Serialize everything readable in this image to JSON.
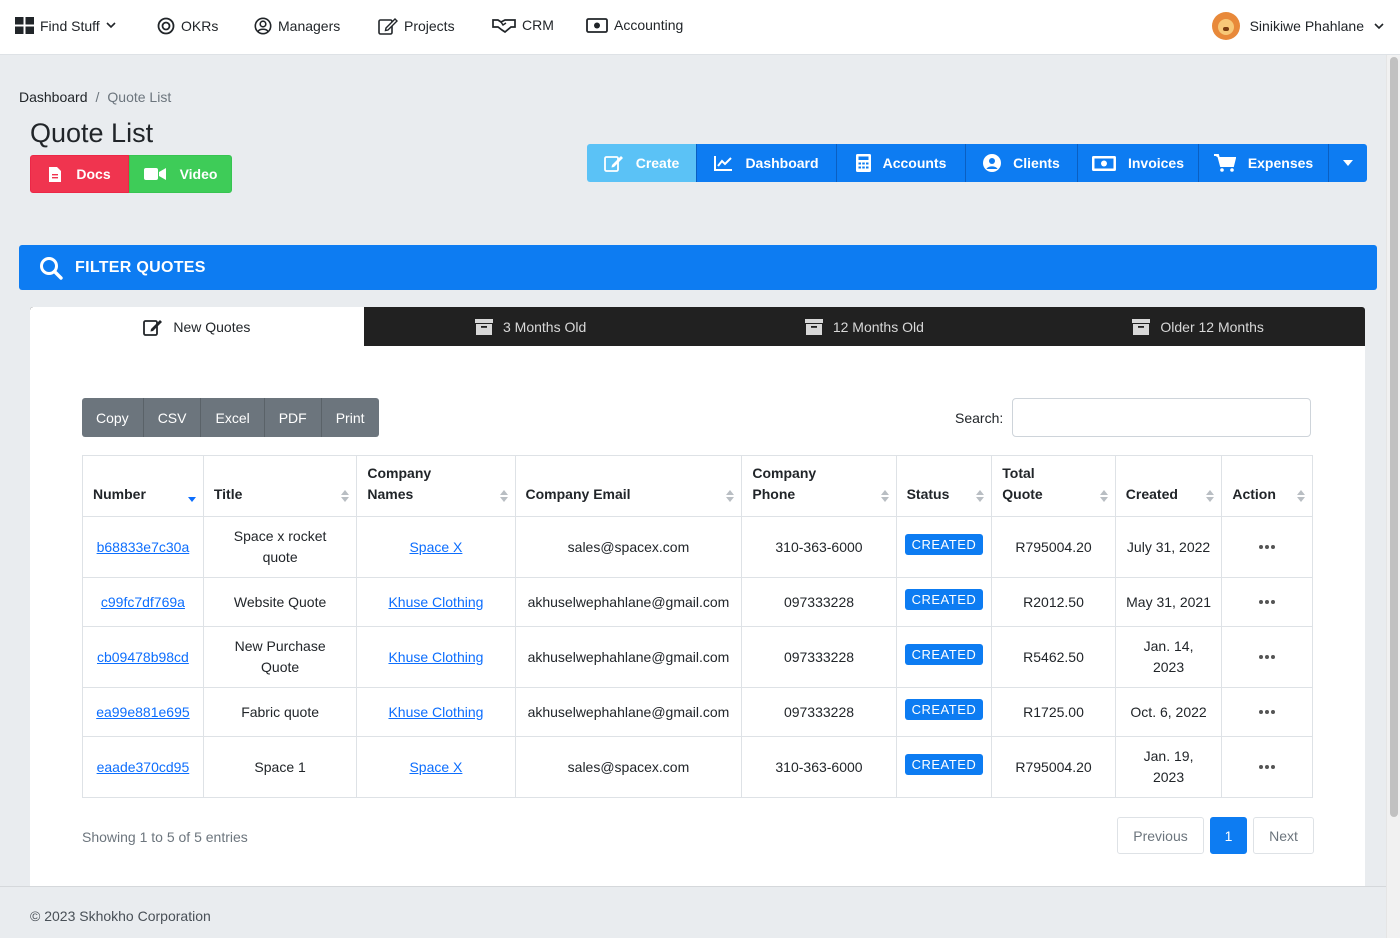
{
  "topnav": {
    "find_stuff": "Find Stuff",
    "okrs": "OKRs",
    "managers": "Managers",
    "projects": "Projects",
    "crm": "CRM",
    "accounting": "Accounting",
    "user_name": "Sinikiwe Phahlane"
  },
  "breadcrumb": {
    "home": "Dashboard",
    "separator": "/",
    "current": "Quote List"
  },
  "page_title": "Quote List",
  "help": {
    "docs": "Docs",
    "video": "Video"
  },
  "actions": {
    "create": "Create",
    "dashboard": "Dashboard",
    "accounts": "Accounts",
    "clients": "Clients",
    "invoices": "Invoices",
    "expenses": "Expenses"
  },
  "filter_label": "FILTER QUOTES",
  "tabs": {
    "new": "New Quotes",
    "three": "3 Months Old",
    "twelve": "12 Months Old",
    "older": "Older 12 Months"
  },
  "export": {
    "copy": "Copy",
    "csv": "CSV",
    "excel": "Excel",
    "pdf": "PDF",
    "print": "Print"
  },
  "search_label": "Search:",
  "table": {
    "headers": [
      "Number",
      "Title",
      "Company Names",
      "Company Email",
      "Company Phone",
      "Status",
      "Total Quote",
      "Created",
      "Action"
    ],
    "rows": [
      {
        "number": "b68833e7c30a",
        "title": "Space x rocket quote",
        "company": "Space X",
        "email": "sales@spacex.com",
        "phone": "310-363-6000",
        "status": "CREATED",
        "total": "R795004.20",
        "created": "July 31, 2022"
      },
      {
        "number": "c99fc7df769a",
        "title": "Website Quote",
        "company": "Khuse Clothing",
        "email": "akhuselwephahlane@gmail.com",
        "phone": "097333228",
        "status": "CREATED",
        "total": "R2012.50",
        "created": "May 31, 2021"
      },
      {
        "number": "cb09478b98cd",
        "title": "New Purchase Quote",
        "company": "Khuse Clothing",
        "email": "akhuselwephahlane@gmail.com",
        "phone": "097333228",
        "status": "CREATED",
        "total": "R5462.50",
        "created": "Jan. 14, 2023"
      },
      {
        "number": "ea99e881e695",
        "title": "Fabric quote",
        "company": "Khuse Clothing",
        "email": "akhuselwephahlane@gmail.com",
        "phone": "097333228",
        "status": "CREATED",
        "total": "R1725.00",
        "created": "Oct. 6, 2022"
      },
      {
        "number": "eaade370cd95",
        "title": "Space 1",
        "company": "Space X",
        "email": "sales@spacex.com",
        "phone": "310-363-6000",
        "status": "CREATED",
        "total": "R795004.20",
        "created": "Jan. 19, 2023"
      }
    ]
  },
  "info": "Showing 1 to 5 of 5 entries",
  "pagination": {
    "previous": "Previous",
    "current": "1",
    "next": "Next"
  },
  "footer": "© 2023 Skhokho Corporation"
}
